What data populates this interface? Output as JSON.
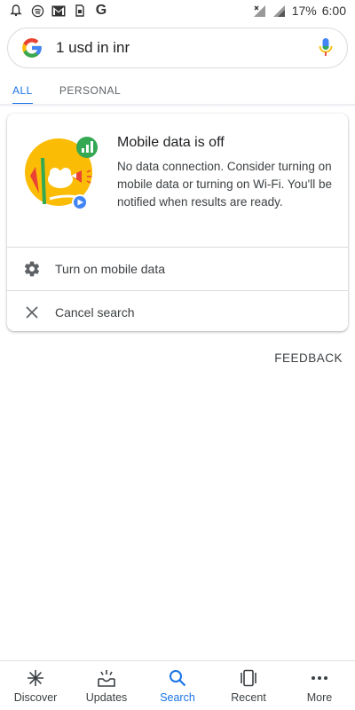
{
  "status_bar": {
    "battery": "17%",
    "time": "6:00",
    "icons": [
      "notification-bell-icon",
      "spotify-icon",
      "gmail-icon",
      "sim-icon",
      "google-icon",
      "no-signal-icon",
      "signal-icon"
    ]
  },
  "search": {
    "query": "1 usd in inr",
    "logo": "google-g-icon",
    "mic": "mic-icon"
  },
  "tabs": [
    {
      "label": "ALL",
      "active": true
    },
    {
      "label": "PERSONAL",
      "active": false
    }
  ],
  "card": {
    "title": "Mobile data is off",
    "body": "No data connection. Consider turning on mobile data or turning on Wi-Fi. You'll be notified when results are ready.",
    "actions": [
      {
        "label": "Turn on mobile data",
        "icon": "gear-icon"
      },
      {
        "label": "Cancel search",
        "icon": "close-icon"
      }
    ]
  },
  "feedback_label": "FEEDBACK",
  "bottom_nav": [
    {
      "label": "Discover",
      "icon": "discover-asterisk-icon",
      "active": false
    },
    {
      "label": "Updates",
      "icon": "updates-inbox-icon",
      "active": false
    },
    {
      "label": "Search",
      "icon": "search-icon",
      "active": true
    },
    {
      "label": "Recent",
      "icon": "recent-cards-icon",
      "active": false
    },
    {
      "label": "More",
      "icon": "more-dots-icon",
      "active": false
    }
  ],
  "colors": {
    "accent": "#1a73e8",
    "google_blue": "#4285f4",
    "google_red": "#ea4335",
    "google_yellow": "#fbbc05",
    "google_green": "#34a853"
  }
}
